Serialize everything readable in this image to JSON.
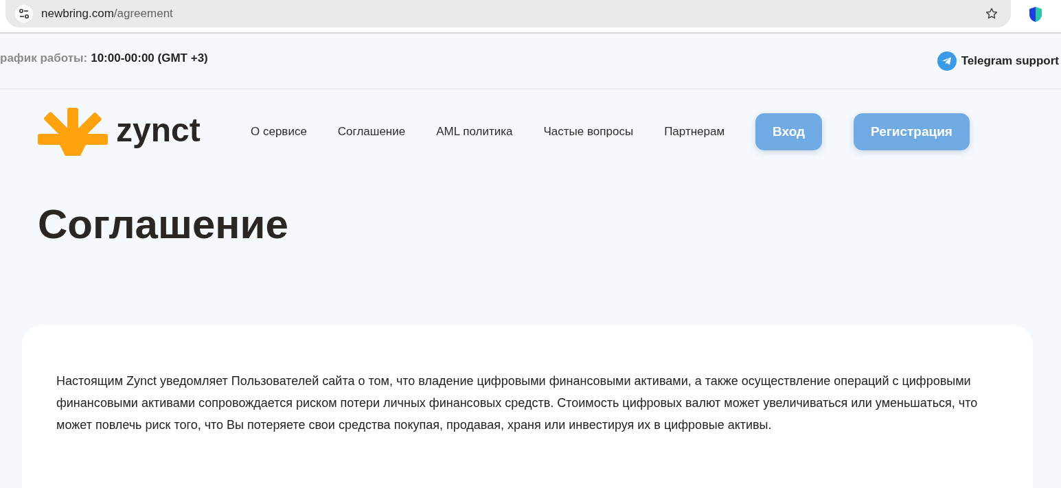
{
  "browser": {
    "url_host": "newbring.com",
    "url_path": "/agreement"
  },
  "top_bar": {
    "schedule_label": "рафик работы:",
    "schedule_value": "10:00-00:00 (GMT +3)",
    "support_link": "Telegram support"
  },
  "header": {
    "logo_text": "zynct",
    "nav": [
      {
        "label": "О сервисе"
      },
      {
        "label": "Соглашение"
      },
      {
        "label": "AML политика"
      },
      {
        "label": "Частые вопросы"
      },
      {
        "label": "Партнерам"
      }
    ],
    "buttons": [
      {
        "label": "Вход"
      },
      {
        "label": "Регистрация"
      }
    ]
  },
  "page_title": "Соглашение",
  "content": {
    "paragraphs": [
      "Настоящим Zynct уведомляет Пользователей сайта о том, что владение цифровыми финансовыми активами, а также осуществление операций с цифровыми финансовыми активами сопровождается риском потери личных финансовых средств. Стоимость цифровых валют может увеличиваться или уменьшаться, что может повлечь риск того, что Вы потеряете свои средства покупая, продавая, храня или инвестируя их в цифровые активы."
    ]
  }
}
